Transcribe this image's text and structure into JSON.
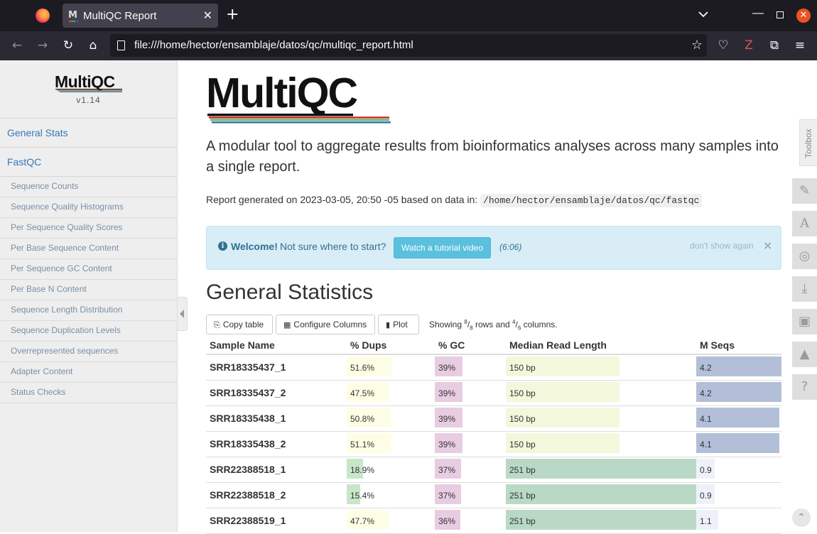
{
  "browser": {
    "tab_title": "MultiQC Report",
    "tab_favicon_letter": "M",
    "url": "file:///home/hector/ensamblaje/datos/qc/multiqc_report.html"
  },
  "sidebar": {
    "logo_text": "MultiQC",
    "version": "v1.14",
    "main_items": [
      "General Stats",
      "FastQC"
    ],
    "sub_items": [
      "Sequence Counts",
      "Sequence Quality Histograms",
      "Per Sequence Quality Scores",
      "Per Base Sequence Content",
      "Per Sequence GC Content",
      "Per Base N Content",
      "Sequence Length Distribution",
      "Sequence Duplication Levels",
      "Overrepresented sequences",
      "Adapter Content",
      "Status Checks"
    ]
  },
  "header": {
    "logo_text": "MultiQC",
    "lead": "A modular tool to aggregate results from bioinformatics analyses across many samples into a single report.",
    "report_generated_prefix": "Report generated on 2023-03-05, 20:50 -05 based on data in:",
    "report_path": "/home/hector/ensamblaje/datos/qc/fastqc"
  },
  "welcome": {
    "strong": "Welcome!",
    "text": "Not sure where to start?",
    "button": "Watch a tutorial video",
    "duration": "(6:06)",
    "dont_show": "don't show again",
    "close": "×"
  },
  "general_stats": {
    "title": "General Statistics",
    "buttons": {
      "copy": "Copy table",
      "configure": "Configure Columns",
      "plot": "Plot"
    },
    "showing": {
      "prefix": "Showing",
      "rows_shown": "8",
      "rows_total": "8",
      "rows_word": "rows and",
      "cols_shown": "4",
      "cols_total": "6",
      "cols_word": "columns."
    },
    "columns": [
      "Sample Name",
      "% Dups",
      "% GC",
      "Median Read Length",
      "M Seqs"
    ],
    "rows": [
      {
        "sample": "SRR18335437_1",
        "dups": "51.6%",
        "dups_value": 51.6,
        "gc": "39%",
        "gc_value": 39,
        "len": "150 bp",
        "len_value": 150,
        "seqs": "4.2",
        "seqs_value": 4.2
      },
      {
        "sample": "SRR18335437_2",
        "dups": "47.5%",
        "dups_value": 47.5,
        "gc": "39%",
        "gc_value": 39,
        "len": "150 bp",
        "len_value": 150,
        "seqs": "4.2",
        "seqs_value": 4.2
      },
      {
        "sample": "SRR18335438_1",
        "dups": "50.8%",
        "dups_value": 50.8,
        "gc": "39%",
        "gc_value": 39,
        "len": "150 bp",
        "len_value": 150,
        "seqs": "4.1",
        "seqs_value": 4.1
      },
      {
        "sample": "SRR18335438_2",
        "dups": "51.1%",
        "dups_value": 51.1,
        "gc": "39%",
        "gc_value": 39,
        "len": "150 bp",
        "len_value": 150,
        "seqs": "4.1",
        "seqs_value": 4.1
      },
      {
        "sample": "SRR22388518_1",
        "dups": "18.9%",
        "dups_value": 18.9,
        "gc": "37%",
        "gc_value": 37,
        "len": "251 bp",
        "len_value": 251,
        "seqs": "0.9",
        "seqs_value": 0.9
      },
      {
        "sample": "SRR22388518_2",
        "dups": "15.4%",
        "dups_value": 15.4,
        "gc": "37%",
        "gc_value": 37,
        "len": "251 bp",
        "len_value": 251,
        "seqs": "0.9",
        "seqs_value": 0.9
      },
      {
        "sample": "SRR22388519_1",
        "dups": "47.7%",
        "dups_value": 47.7,
        "gc": "36%",
        "gc_value": 36,
        "len": "251 bp",
        "len_value": 251,
        "seqs": "1.1",
        "seqs_value": 1.1
      }
    ]
  },
  "toolbox": {
    "label": "Toolbox",
    "tools": [
      "pin-icon",
      "font-icon",
      "eye-slash-icon",
      "download-icon",
      "save-icon",
      "graduation-cap-icon",
      "help-icon"
    ]
  },
  "colors": {
    "link": "#337ab7",
    "info_bg": "#d9edf7",
    "info_text": "#31708f",
    "btn_info": "#5bc0de"
  }
}
